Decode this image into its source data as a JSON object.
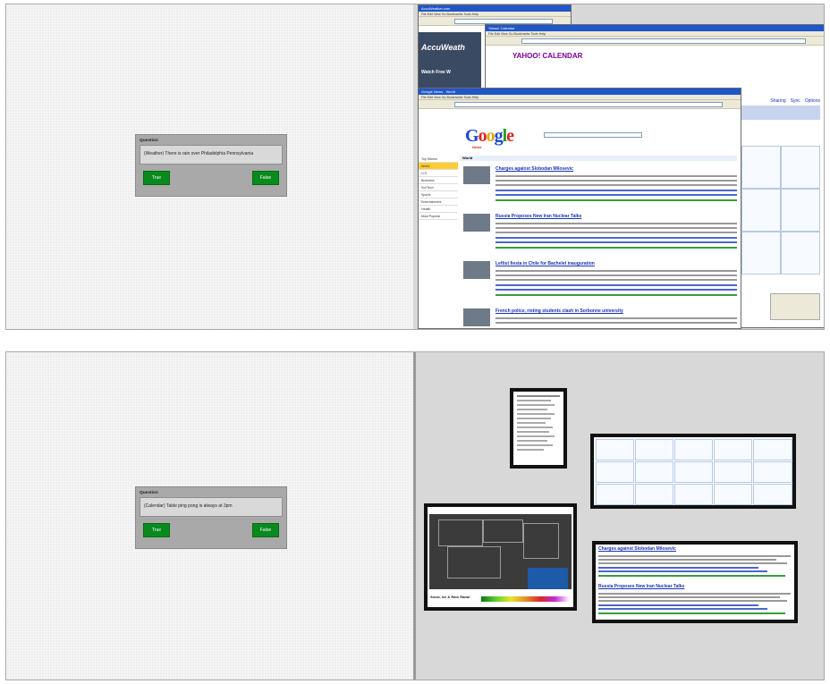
{
  "panel_top": {
    "dialog": {
      "title": "Question",
      "question": "(Weather) There is rain over Philadelphia Pennsylvania",
      "true_label": "True",
      "false_label": "False"
    },
    "windows": {
      "accuweather_title": "AccuWeather.com",
      "calendar_brand": "YAHOO! CALENDAR",
      "calendar_tabs": [
        "Sharing",
        "Sync",
        "Options"
      ],
      "google_news_title": "Google News - World",
      "google_logo": "Google",
      "google_sub": "News",
      "section": "World",
      "nav": [
        "Top Stories",
        "World",
        "U.S.",
        "Business",
        "Sci/Tech",
        "Sports",
        "Entertainment",
        "Health",
        "Most Popular"
      ],
      "stories": [
        "Charges against Slobodan Milosevic",
        "Russia Proposes New Iran Nuclear Talks",
        "Leftist fiesta in Chile for Bachelet inauguration",
        "French police, rioting students clash in Sorbonne university"
      ]
    }
  },
  "panel_bottom": {
    "dialog": {
      "title": "Question",
      "question": "(Calendar) Table ping pong is always at 3pm",
      "true_label": "True",
      "false_label": "False"
    },
    "snippets": {
      "news_headlines": [
        "Charges against Slobodan Milosevic",
        "Russia Proposes New Iran Nuclear Talks"
      ],
      "map_caption": "Snow, Ice & Rain Radar"
    }
  },
  "colors": {
    "button_green": "#0a8a1e",
    "title_blue": "#1f56c9",
    "link_blue": "#1a33b0"
  }
}
